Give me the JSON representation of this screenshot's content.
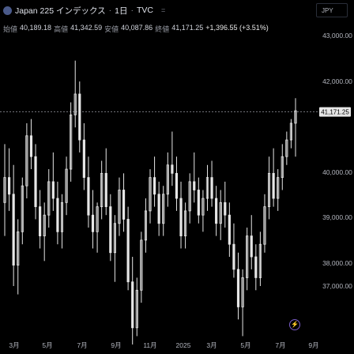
{
  "header": {
    "symbol": "Japan 225 インデックス",
    "interval": "1日",
    "source": "TVC",
    "currency": "JPY"
  },
  "ohlc": {
    "open_label": "始値",
    "open": "40,189.18",
    "high_label": "高値",
    "high": "41,342.59",
    "low_label": "安値",
    "low": "40,087.86",
    "close_label": "終値",
    "close": "41,171.25",
    "change": "+1,396.55 (+3.51%)"
  },
  "colors": {
    "background": "#000000",
    "candle": "#e6e6e6",
    "grid": "#2a2e39",
    "price_line": "#9598a1"
  },
  "icons": {
    "logo": "japan-flag-icon",
    "settings": "equals-icon",
    "bolt": "lightning-icon"
  },
  "chart_data": {
    "type": "candlestick",
    "x_ticks": [
      "3月",
      "5月",
      "7月",
      "9月",
      "11月",
      "2025",
      "3月",
      "5月",
      "7月",
      "9月"
    ],
    "y_ticks": [
      "43,000.00",
      "42,000.00",
      "40,000.00",
      "39,000.00",
      "38,000.00",
      "37,000.00"
    ],
    "ylim": [
      36500,
      43500
    ],
    "last_price": "41,171.25",
    "last_price_value": 41171.25,
    "grid": false,
    "points": [
      [
        39000,
        40400,
        38200,
        39600
      ],
      [
        39600,
        40300,
        38800,
        39200
      ],
      [
        39200,
        39900,
        37000,
        37500
      ],
      [
        37500,
        38600,
        36800,
        38300
      ],
      [
        38300,
        39600,
        38000,
        39400
      ],
      [
        39400,
        40900,
        39100,
        40600
      ],
      [
        40600,
        41000,
        39800,
        40100
      ],
      [
        40100,
        40400,
        38600,
        38900
      ],
      [
        38900,
        39300,
        37900,
        38200
      ],
      [
        38200,
        39000,
        37600,
        38700
      ],
      [
        38700,
        39800,
        38400,
        39500
      ],
      [
        39500,
        40200,
        38800,
        39100
      ],
      [
        39100,
        39500,
        38000,
        38300
      ],
      [
        38300,
        39200,
        37900,
        39000
      ],
      [
        39000,
        40100,
        38700,
        39800
      ],
      [
        39800,
        41400,
        39500,
        41100
      ],
      [
        41100,
        42400,
        40800,
        41600
      ],
      [
        41600,
        41900,
        40200,
        40500
      ],
      [
        40500,
        40900,
        39300,
        39600
      ],
      [
        39600,
        40100,
        38400,
        38700
      ],
      [
        38700,
        39300,
        37900,
        38300
      ],
      [
        38300,
        39000,
        37800,
        38900
      ],
      [
        38900,
        40000,
        38600,
        39700
      ],
      [
        39700,
        40300,
        38700,
        38900
      ],
      [
        38900,
        39200,
        37600,
        37800
      ],
      [
        37800,
        38700,
        37100,
        38500
      ],
      [
        38500,
        39600,
        38200,
        39300
      ],
      [
        39300,
        39700,
        38300,
        38600
      ],
      [
        38600,
        38900,
        36900,
        37100
      ],
      [
        37100,
        37700,
        35600,
        36000
      ],
      [
        36000,
        37200,
        35800,
        36900
      ],
      [
        36900,
        38300,
        36600,
        38100
      ],
      [
        38100,
        39100,
        37800,
        38800
      ],
      [
        38800,
        39800,
        38500,
        39600
      ],
      [
        39600,
        40100,
        38900,
        39200
      ],
      [
        39200,
        39500,
        38200,
        38500
      ],
      [
        38500,
        39400,
        38200,
        39200
      ],
      [
        39200,
        40200,
        38900,
        39900
      ],
      [
        39900,
        40700,
        39400,
        39700
      ],
      [
        39700,
        40100,
        38800,
        39100
      ],
      [
        39100,
        39500,
        37900,
        38200
      ],
      [
        38200,
        39000,
        37900,
        38800
      ],
      [
        38800,
        39700,
        38500,
        39500
      ],
      [
        39500,
        40200,
        39000,
        39300
      ],
      [
        39300,
        39600,
        38500,
        38700
      ],
      [
        38700,
        39300,
        38300,
        39100
      ],
      [
        39100,
        39900,
        38800,
        39600
      ],
      [
        39600,
        40000,
        38900,
        39100
      ],
      [
        39100,
        39400,
        38200,
        38500
      ],
      [
        38500,
        39300,
        38100,
        39000
      ],
      [
        39000,
        39500,
        38400,
        38700
      ],
      [
        38700,
        39000,
        37700,
        38000
      ],
      [
        38000,
        38500,
        37200,
        37400
      ],
      [
        37400,
        37800,
        36200,
        36500
      ],
      [
        36500,
        37400,
        35800,
        37200
      ],
      [
        37200,
        38400,
        36900,
        38200
      ],
      [
        38200,
        38700,
        37400,
        37700
      ],
      [
        37700,
        38000,
        36900,
        37200
      ],
      [
        37200,
        38300,
        37000,
        38000
      ],
      [
        38000,
        39200,
        37800,
        38900
      ],
      [
        38900,
        40100,
        38600,
        39700
      ],
      [
        39700,
        40300,
        38900,
        39100
      ],
      [
        39100,
        39800,
        38800,
        39600
      ],
      [
        39600,
        40400,
        39300,
        40100
      ],
      [
        40100,
        40700,
        39900,
        40500
      ],
      [
        40500,
        41000,
        40300,
        40900
      ],
      [
        40900,
        41500,
        40100,
        41200
      ]
    ]
  }
}
